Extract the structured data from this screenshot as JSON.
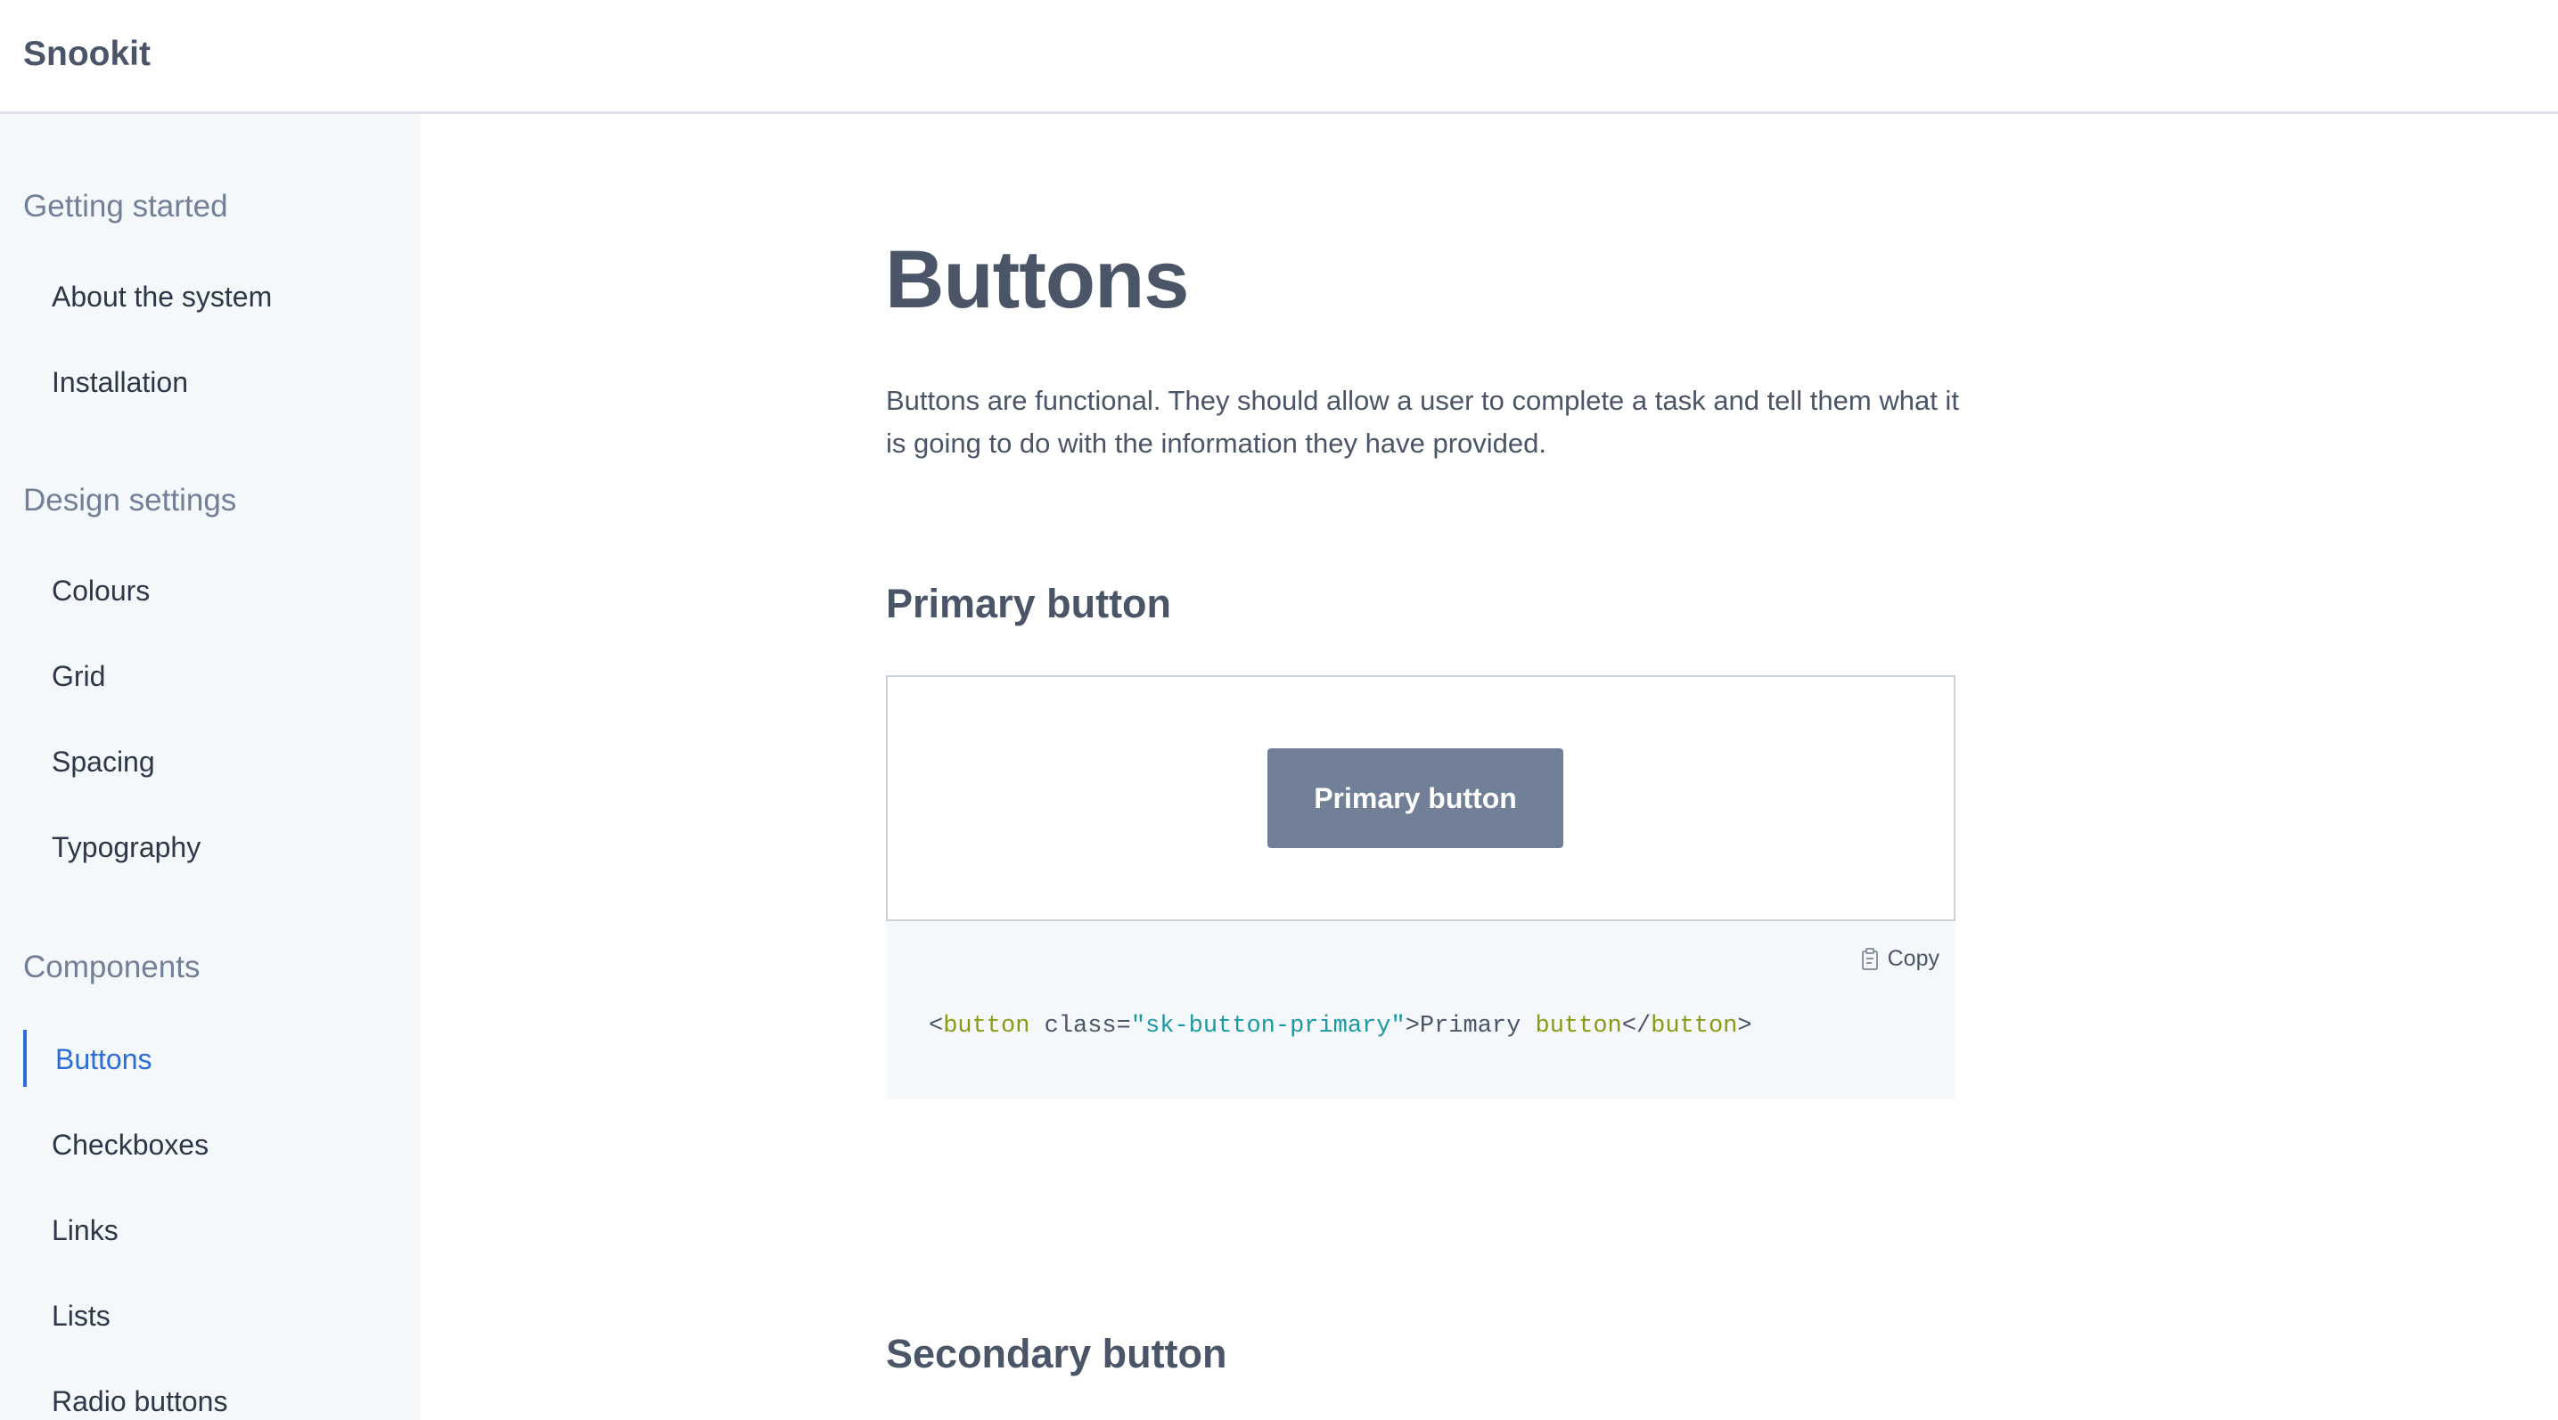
{
  "header": {
    "brand": "Snookit"
  },
  "sidebar": {
    "groups": [
      {
        "heading": "Getting started",
        "items": [
          {
            "label": "About the system"
          },
          {
            "label": "Installation"
          }
        ]
      },
      {
        "heading": "Design settings",
        "items": [
          {
            "label": "Colours"
          },
          {
            "label": "Grid"
          },
          {
            "label": "Spacing"
          },
          {
            "label": "Typography"
          }
        ]
      },
      {
        "heading": "Components",
        "items": [
          {
            "label": "Buttons",
            "active": true
          },
          {
            "label": "Checkboxes"
          },
          {
            "label": "Links"
          },
          {
            "label": "Lists"
          },
          {
            "label": "Radio buttons"
          }
        ]
      }
    ]
  },
  "main": {
    "title": "Buttons",
    "intro": "Buttons are functional. They should allow a user to complete a task and tell them what it is going to do with the information they have provided.",
    "sections": [
      {
        "title": "Primary button",
        "demo_button_label": "Primary button",
        "copy_label": "Copy",
        "code": {
          "open_lt": "<",
          "tag": "button",
          "attr": " class=",
          "attr_value": "\"sk-button-primary\"",
          "open_gt": ">",
          "text": "Primary ",
          "text_keyword": "button",
          "close_lt": "</",
          "close_tag": "button",
          "close_gt": ">"
        }
      },
      {
        "title": "Secondary button"
      }
    ]
  },
  "colors": {
    "accent": "#2b6fd6",
    "primary_button_bg": "#718096",
    "sidebar_bg": "#f5f8fb",
    "text": "#4a5568",
    "code_tag": "#8a9a12",
    "code_string": "#1a9aa0"
  },
  "icons": {
    "copy": "clipboard-icon"
  }
}
